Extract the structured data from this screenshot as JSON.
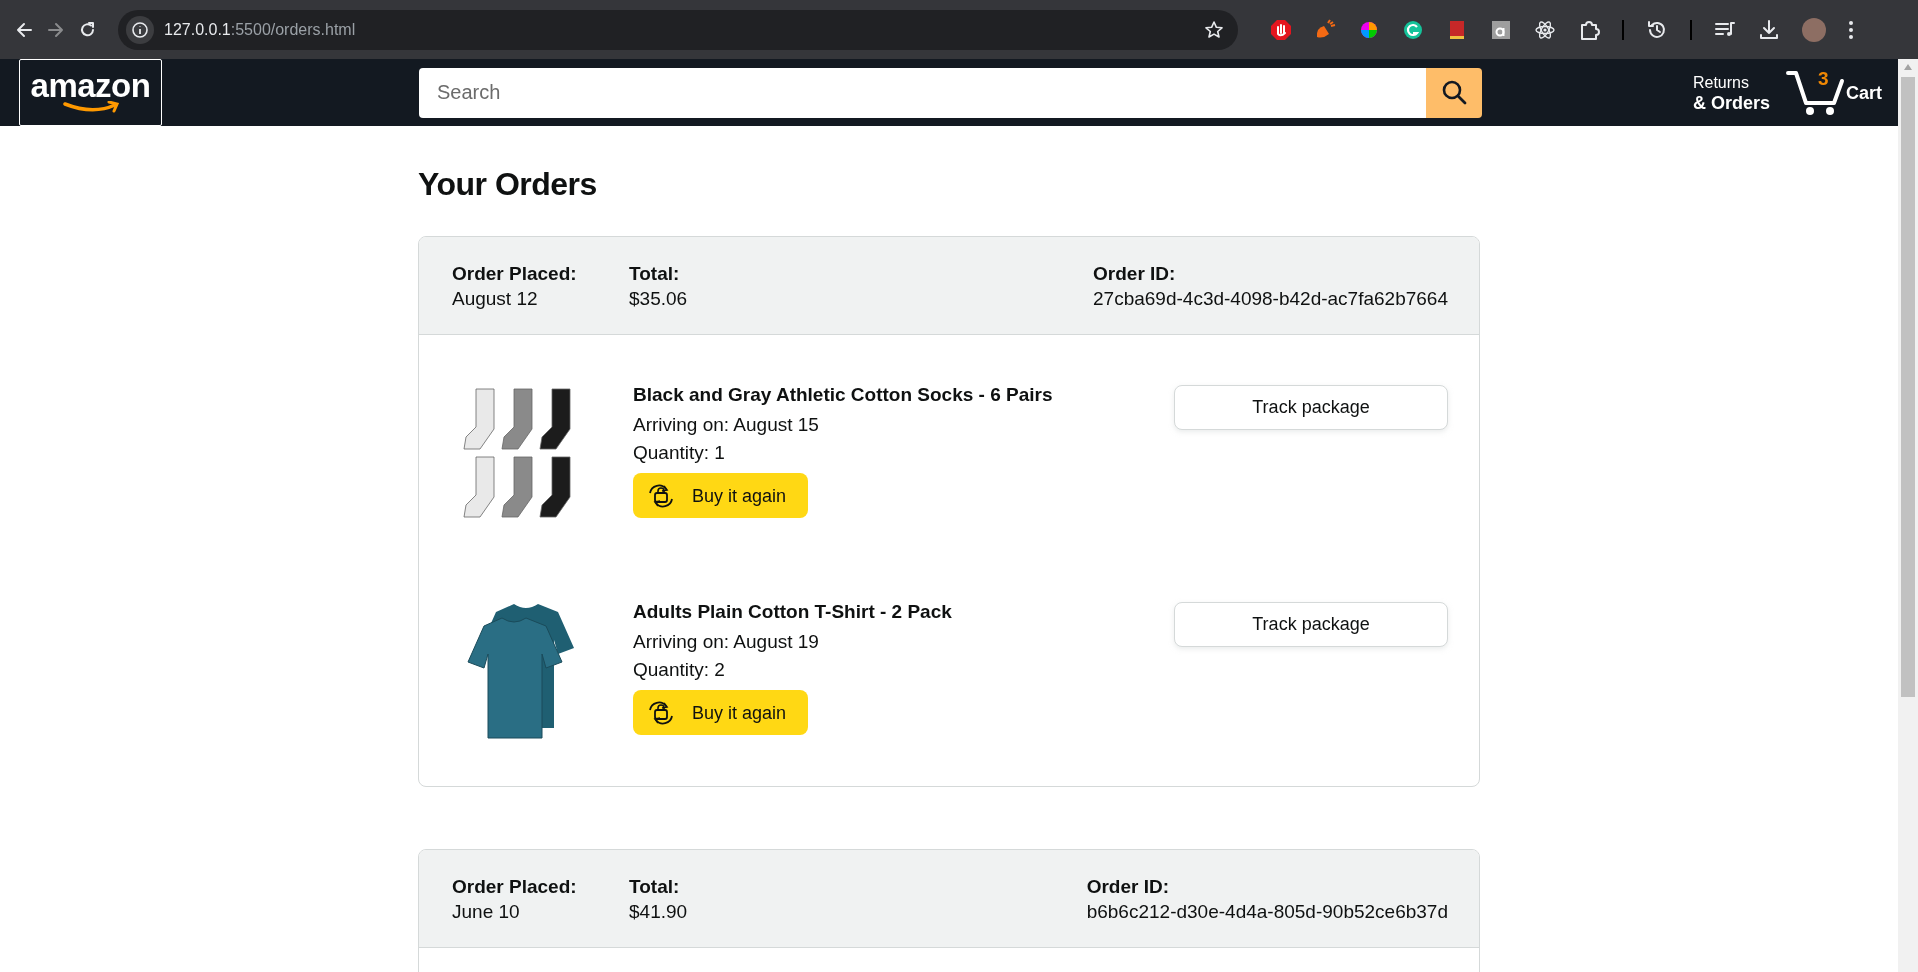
{
  "browser": {
    "url_host": "127.0.0.1",
    "url_rest": ":5500/orders.html"
  },
  "header": {
    "logo": "amazon",
    "search": {
      "placeholder": "Search"
    },
    "returns_line1": "Returns",
    "returns_line2": "& Orders",
    "cart_count": "3",
    "cart_label": "Cart"
  },
  "page_title": "Your Orders",
  "orders": [
    {
      "placed_label": "Order Placed:",
      "placed": "August 12",
      "total_label": "Total:",
      "total": "$35.06",
      "id_label": "Order ID:",
      "id": "27cba69d-4c3d-4098-b42d-ac7fa62b7664",
      "items": [
        {
          "kind": "socks",
          "name": "Black and Gray Athletic Cotton Socks - 6 Pairs",
          "arriving": "Arriving on: August 15",
          "quantity": "Quantity: 1",
          "buy_again": "Buy it again",
          "track": "Track package"
        },
        {
          "kind": "tshirt",
          "name": "Adults Plain Cotton T-Shirt - 2 Pack",
          "arriving": "Arriving on: August 19",
          "quantity": "Quantity: 2",
          "buy_again": "Buy it again",
          "track": "Track package"
        }
      ]
    },
    {
      "placed_label": "Order Placed:",
      "placed": "June 10",
      "total_label": "Total:",
      "total": "$41.90",
      "id_label": "Order ID:",
      "id": "b6b6c212-d30e-4d4a-805d-90b52ce6b37d"
    }
  ]
}
